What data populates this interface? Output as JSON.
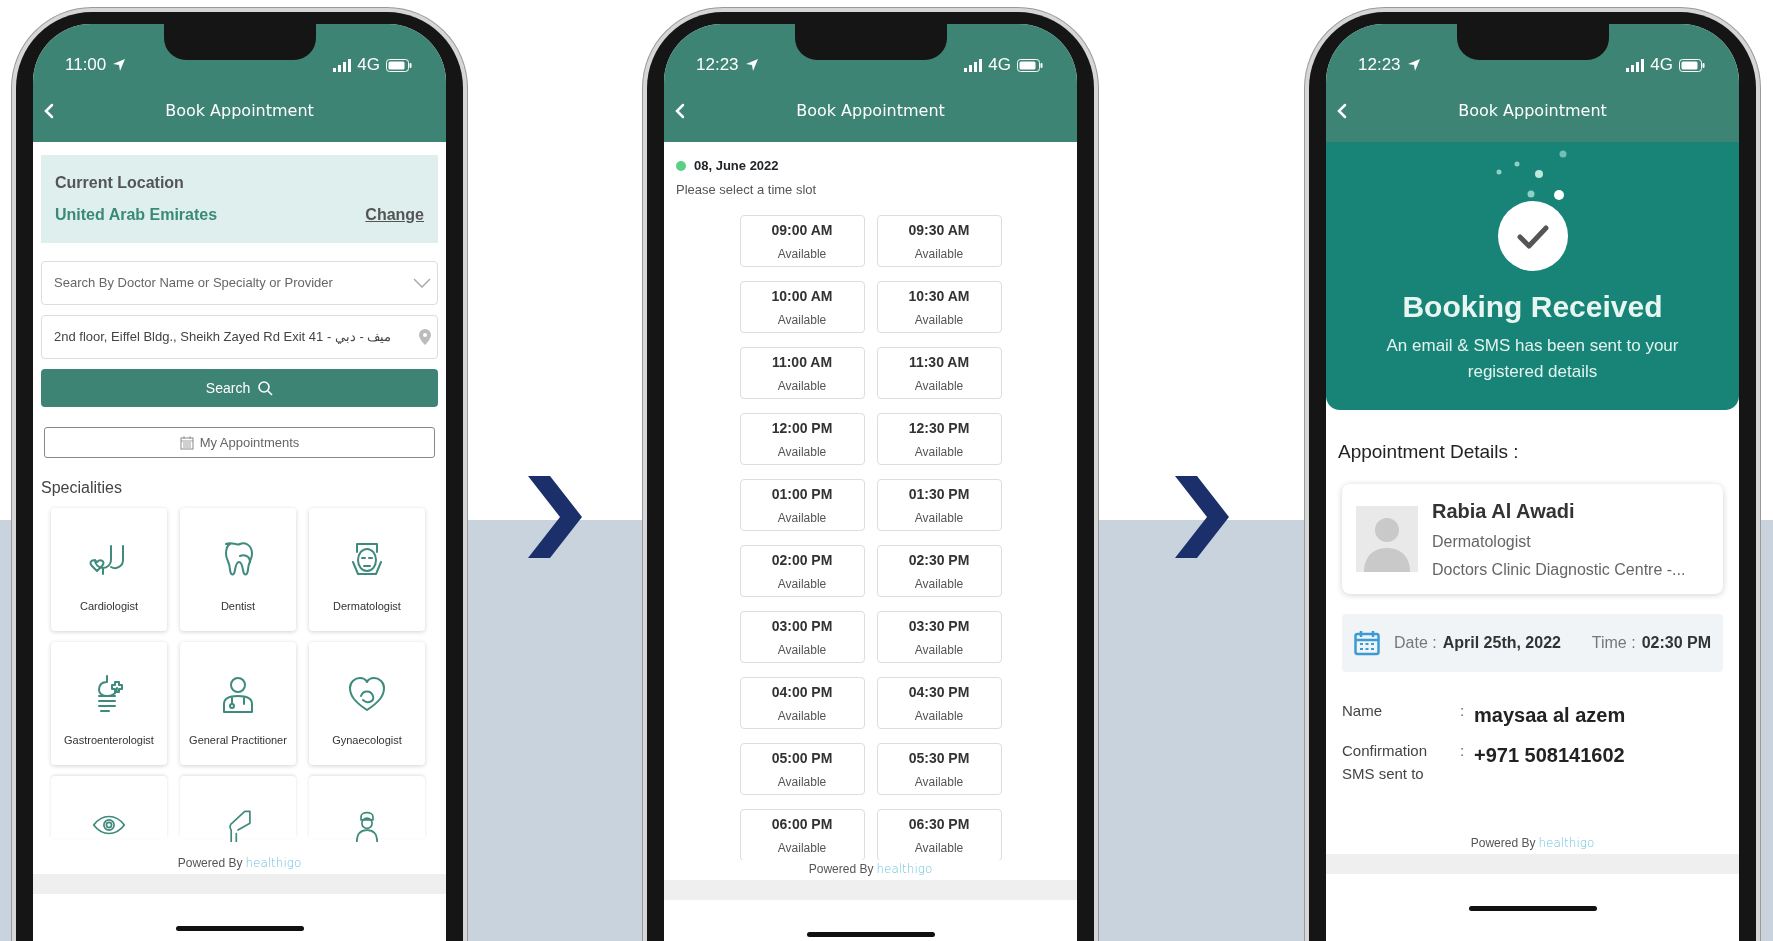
{
  "screens": [
    {
      "kind": "search",
      "status": {
        "time": "11:00",
        "network": "4G"
      },
      "header": {
        "title": "Book Appointment"
      },
      "location": {
        "label": "Current Location",
        "value": "United Arab Emirates",
        "action": "Change"
      },
      "doctor_search": {
        "placeholder": "Search By Doctor Name or Specialty or Provider"
      },
      "address": {
        "value": "2nd floor, Eiffel Bldg., Sheikh Zayed Rd Exit 41 - ميف - دبي"
      },
      "search_button": "Search",
      "appointments_button": "My Appointments",
      "specialities_title": "Specialities",
      "specialities": [
        {
          "kind": "card",
          "label": "Cardiologist"
        },
        {
          "kind": "card",
          "label": "Dentist"
        },
        {
          "kind": "card",
          "label": "Dermatologist"
        },
        {
          "kind": "card",
          "label": "Gastroenterologist"
        },
        {
          "kind": "card",
          "label": "General Practitioner"
        },
        {
          "kind": "card",
          "label": "Gynaecologist"
        },
        {
          "kind": "partial"
        },
        {
          "kind": "partial"
        },
        {
          "kind": "partial"
        }
      ],
      "footer": {
        "text": "Powered By",
        "brand": "healthigo"
      }
    },
    {
      "kind": "slots",
      "status": {
        "time": "12:23",
        "network": "4G"
      },
      "header": {
        "title": "Book Appointment"
      },
      "date": {
        "text": "08, June 2022",
        "color": "#5ccf86"
      },
      "instruction": "Please select a time slot",
      "slots": [
        {
          "time": "09:00 AM",
          "status": "Available"
        },
        {
          "time": "09:30 AM",
          "status": "Available"
        },
        {
          "time": "10:00 AM",
          "status": "Available"
        },
        {
          "time": "10:30 AM",
          "status": "Available"
        },
        {
          "time": "11:00 AM",
          "status": "Available"
        },
        {
          "time": "11:30 AM",
          "status": "Available"
        },
        {
          "time": "12:00 PM",
          "status": "Available"
        },
        {
          "time": "12:30 PM",
          "status": "Available"
        },
        {
          "time": "01:00 PM",
          "status": "Available"
        },
        {
          "time": "01:30 PM",
          "status": "Available"
        },
        {
          "time": "02:00 PM",
          "status": "Available"
        },
        {
          "time": "02:30 PM",
          "status": "Available"
        },
        {
          "time": "03:00 PM",
          "status": "Available"
        },
        {
          "time": "03:30 PM",
          "status": "Available"
        },
        {
          "time": "04:00 PM",
          "status": "Available"
        },
        {
          "time": "04:30 PM",
          "status": "Available"
        },
        {
          "time": "05:00 PM",
          "status": "Available"
        },
        {
          "time": "05:30 PM",
          "status": "Available"
        },
        {
          "time": "06:00 PM",
          "status": "Available"
        },
        {
          "time": "06:30 PM",
          "status": "Available"
        }
      ],
      "footer": {
        "text": "Powered By",
        "brand": "healthigo"
      }
    },
    {
      "kind": "confirmation",
      "status": {
        "time": "12:23",
        "network": "4G"
      },
      "header": {
        "title": "Book Appointment"
      },
      "banner": {
        "title": "Booking Received",
        "message": "An email & SMS has been sent to your registered details"
      },
      "details_title": "Appointment Details :",
      "doctor": {
        "name": "Rabia Al Awadi",
        "specialty": "Dermatologist",
        "clinic": "Doctors Clinic Diagnostic Centre -..."
      },
      "schedule": {
        "date_label": "Date :",
        "date": "April 25th, 2022",
        "time_label": "Time :",
        "time": "02:30 PM"
      },
      "rows": [
        {
          "label": "Name",
          "separator": ":",
          "value": "maysaa al azem"
        },
        {
          "label": "Confirmation SMS sent to",
          "separator": ":",
          "value": "+971 508141602"
        }
      ],
      "footer": {
        "text": "Powered By",
        "brand": "healthigo"
      }
    }
  ]
}
